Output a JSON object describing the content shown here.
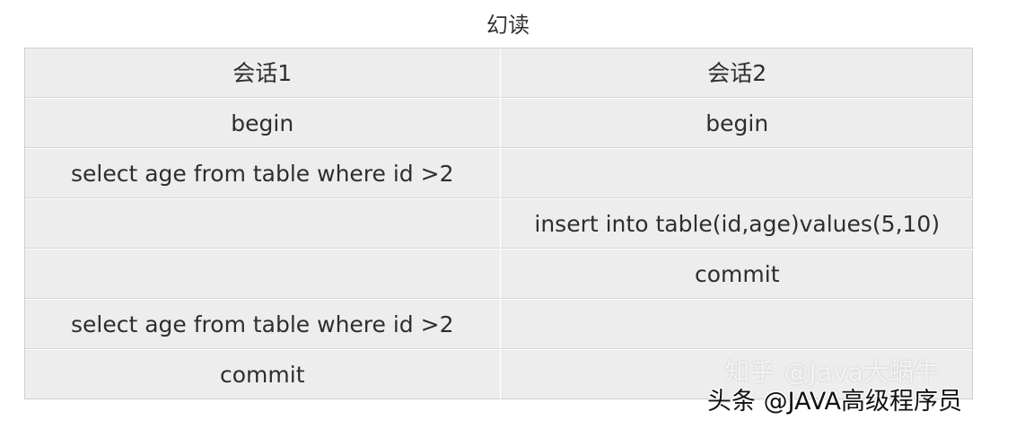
{
  "title": "幻读",
  "table": {
    "headers": [
      "会话1",
      "会话2"
    ],
    "rows": [
      [
        "begin",
        "begin"
      ],
      [
        "select age from table where id >2",
        ""
      ],
      [
        "",
        "insert into table(id,age)values(5,10)"
      ],
      [
        "",
        "commit"
      ],
      [
        "select age from table where id >2",
        ""
      ],
      [
        "commit",
        ""
      ]
    ]
  },
  "watermarks": {
    "zhihu": "知乎 @Java大蜗牛",
    "toutiao": "头条 @JAVA高级程序员"
  }
}
